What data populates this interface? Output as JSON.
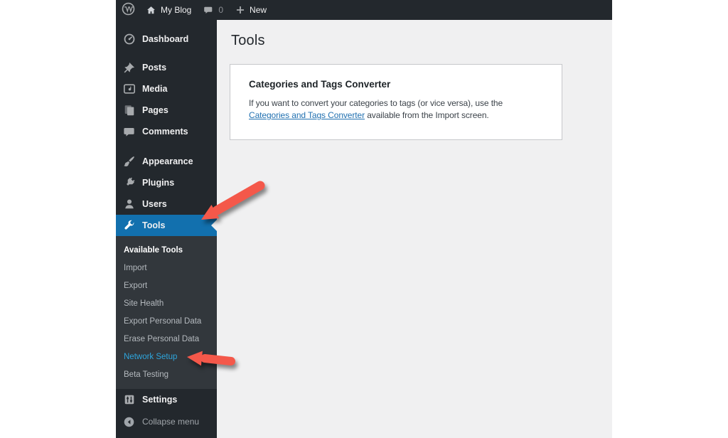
{
  "admin_bar": {
    "site_name": "My Blog",
    "comment_count": "0",
    "new_label": "New"
  },
  "sidebar": {
    "items": [
      {
        "label": "Dashboard",
        "icon": "dashboard-icon"
      },
      {
        "label": "Posts",
        "icon": "pin-icon"
      },
      {
        "label": "Media",
        "icon": "media-icon"
      },
      {
        "label": "Pages",
        "icon": "pages-icon"
      },
      {
        "label": "Comments",
        "icon": "comment-bubble-icon"
      },
      {
        "label": "Appearance",
        "icon": "brush-icon"
      },
      {
        "label": "Plugins",
        "icon": "plug-icon"
      },
      {
        "label": "Users",
        "icon": "user-icon"
      },
      {
        "label": "Tools",
        "icon": "wrench-icon",
        "state": "current"
      },
      {
        "label": "Settings",
        "icon": "sliders-icon"
      }
    ],
    "tools_submenu": [
      {
        "label": "Available Tools",
        "state": "current"
      },
      {
        "label": "Import"
      },
      {
        "label": "Export"
      },
      {
        "label": "Site Health"
      },
      {
        "label": "Export Personal Data"
      },
      {
        "label": "Erase Personal Data"
      },
      {
        "label": "Network Setup",
        "state": "highlighted"
      },
      {
        "label": "Beta Testing"
      }
    ],
    "collapse_label": "Collapse menu"
  },
  "main": {
    "page_title": "Tools",
    "card": {
      "title": "Categories and Tags Converter",
      "text_before_link": "If you want to convert your categories to tags (or vice versa), use the ",
      "link_text": "Categories and Tags Converter",
      "text_after_link": " available from the Import screen."
    }
  },
  "colors": {
    "admin_dark": "#23282d",
    "submenu_bg": "#32373c",
    "highlight_blue": "#1270ae",
    "submenu_link_cyan": "#2ea5dc",
    "content_bg": "#f0f0f1",
    "link_blue": "#2271b1",
    "arrow_red": "#f4584a"
  }
}
